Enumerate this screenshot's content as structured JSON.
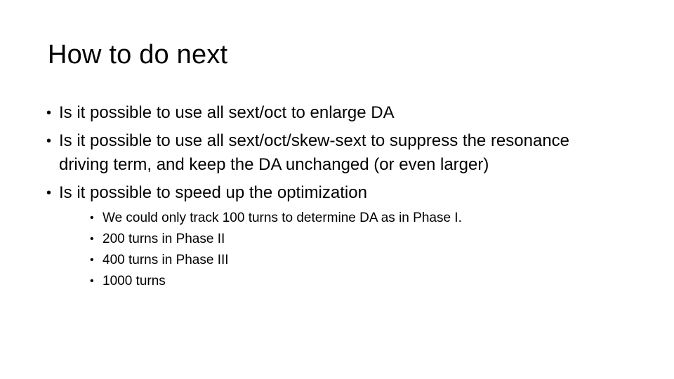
{
  "slide": {
    "title": "How to do next",
    "bullet_marker": "•",
    "sub_bullet_marker": "•",
    "bullets": [
      {
        "text": "Is it possible to use all sext/oct to enlarge DA",
        "lines": [
          "Is it possible to use all sext/oct to enlarge DA"
        ]
      },
      {
        "text": "Is it possible to use all sext/oct/skew-sext to suppress the resonance driving term, and keep the DA unchanged (or even larger)",
        "lines": [
          "Is it possible to use all sext/oct/skew-sext to suppress the resonance",
          "driving term, and keep the DA unchanged (or even larger)"
        ]
      },
      {
        "text": "Is it possible to speed up the optimization",
        "lines": [
          "Is it possible to speed up the optimization"
        ],
        "sub_bullets": [
          "We could only track 100 turns to determine DA as in Phase I.",
          "200 turns in Phase II",
          "400 turns in Phase III",
          "1000 turns"
        ]
      }
    ]
  },
  "colors": {
    "background": "#ffffff",
    "text": "#000000"
  }
}
